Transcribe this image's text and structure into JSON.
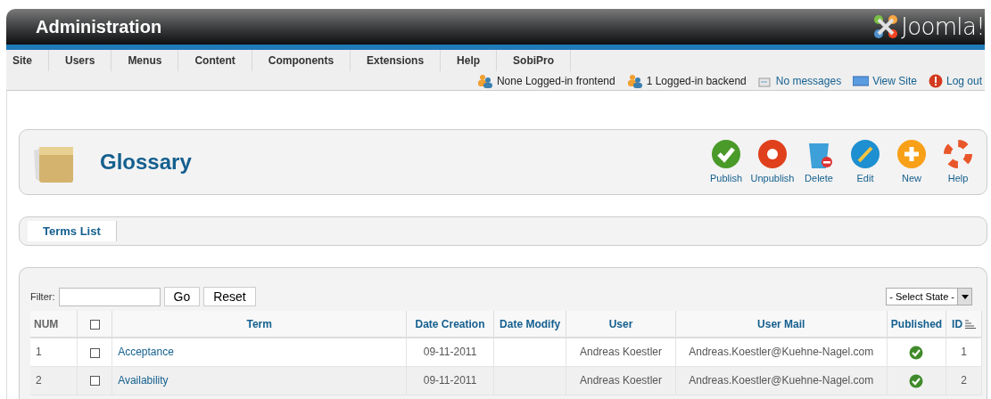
{
  "header": {
    "title": "Administration",
    "logo_text": "Joomla!"
  },
  "menu": [
    "Site",
    "Users",
    "Menus",
    "Content",
    "Components",
    "Extensions",
    "Help",
    "SobiPro"
  ],
  "status": [
    {
      "kind": "users",
      "label": "None Logged-in frontend"
    },
    {
      "kind": "users",
      "label": "1 Logged-in backend"
    },
    {
      "kind": "mail",
      "label": "No messages"
    },
    {
      "kind": "screen",
      "label": "View Site"
    },
    {
      "kind": "logout",
      "label": "Log out"
    }
  ],
  "page_title": "Glossary",
  "toolbar": [
    {
      "kind": "publish",
      "label": "Publish"
    },
    {
      "kind": "unpublish",
      "label": "Unpublish"
    },
    {
      "kind": "delete",
      "label": "Delete"
    },
    {
      "kind": "edit",
      "label": "Edit"
    },
    {
      "kind": "new",
      "label": "New"
    },
    {
      "kind": "help",
      "label": "Help"
    }
  ],
  "tabs": [
    {
      "label": "Terms List",
      "selected": true
    }
  ],
  "filter": {
    "label": "Filter:",
    "go": "Go",
    "reset": "Reset",
    "state_select": "- Select State -"
  },
  "table": {
    "columns": [
      "NUM",
      "Term",
      "Date Creation",
      "Date Modify",
      "User",
      "User Mail",
      "Published",
      "ID"
    ],
    "header_checked": false,
    "rows": [
      {
        "num": "1",
        "checked": false,
        "term": "Acceptance",
        "date_creation": "09-11-2011",
        "user": "Andreas Koestler",
        "user_mail": "Andreas.Koestler@Kuehne-Nagel.com",
        "published": true,
        "id": "1"
      },
      {
        "num": "2",
        "checked": false,
        "term": "Availability",
        "date_creation": "09-11-2011",
        "user": "Andreas Koestler",
        "user_mail": "Andreas.Koestler@Kuehne-Nagel.com",
        "published": true,
        "id": "2"
      }
    ]
  }
}
